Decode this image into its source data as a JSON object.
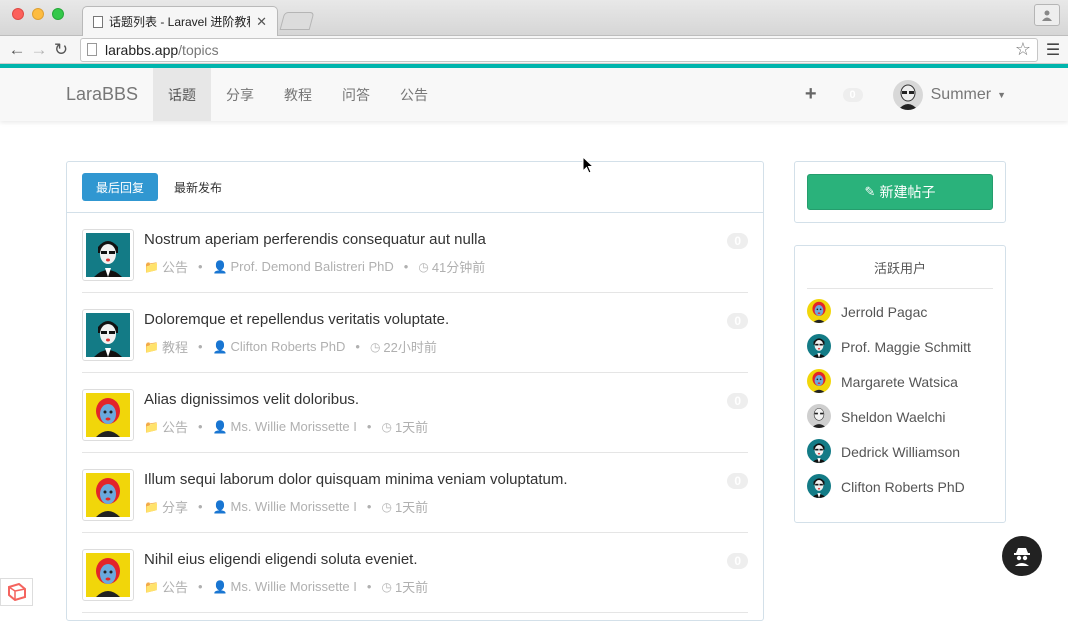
{
  "browser": {
    "tab_title": "话题列表 - Laravel 进阶教程",
    "tab_close": "✕",
    "url_host": "larabbs.app",
    "url_path": "/topics"
  },
  "site": {
    "brand": "LaraBBS",
    "nav": [
      {
        "label": "话题"
      },
      {
        "label": "分享"
      },
      {
        "label": "教程"
      },
      {
        "label": "问答"
      },
      {
        "label": "公告"
      }
    ],
    "plus": "+",
    "notification_count": "0",
    "user_name": "Summer"
  },
  "topics_panel": {
    "pills": [
      {
        "label": "最后回复"
      },
      {
        "label": "最新发布"
      }
    ],
    "topics": [
      {
        "title": "Nostrum aperiam perferendis consequatur aut nulla",
        "category": "公告",
        "author": "Prof. Demond Balistreri PhD",
        "time": "41分钟前",
        "replies": "0",
        "avatar": "teal"
      },
      {
        "title": "Doloremque et repellendus veritatis voluptate.",
        "category": "教程",
        "author": "Clifton Roberts PhD",
        "time": "22小时前",
        "replies": "0",
        "avatar": "teal"
      },
      {
        "title": "Alias dignissimos velit doloribus.",
        "category": "公告",
        "author": "Ms. Willie Morissette I",
        "time": "1天前",
        "replies": "0",
        "avatar": "yellow"
      },
      {
        "title": "Illum sequi laborum dolor quisquam minima veniam voluptatum.",
        "category": "分享",
        "author": "Ms. Willie Morissette I",
        "time": "1天前",
        "replies": "0",
        "avatar": "yellow"
      },
      {
        "title": "Nihil eius eligendi eligendi soluta eveniet.",
        "category": "公告",
        "author": "Ms. Willie Morissette I",
        "time": "1天前",
        "replies": "0",
        "avatar": "yellow"
      }
    ]
  },
  "sidebar": {
    "create_label": "新建帖子",
    "active_title": "活跃用户",
    "active_users": [
      {
        "name": "Jerrold Pagac",
        "avatar": "yellow"
      },
      {
        "name": "Prof. Maggie Schmitt",
        "avatar": "teal"
      },
      {
        "name": "Margarete Watsica",
        "avatar": "yellow"
      },
      {
        "name": "Sheldon Waelchi",
        "avatar": "gray"
      },
      {
        "name": "Dedrick Williamson",
        "avatar": "teal"
      },
      {
        "name": "Clifton Roberts PhD",
        "avatar": "teal"
      }
    ]
  },
  "colors": {
    "accent": "#00b5ad",
    "primary": "#3097d1",
    "success": "#2ab27b"
  }
}
